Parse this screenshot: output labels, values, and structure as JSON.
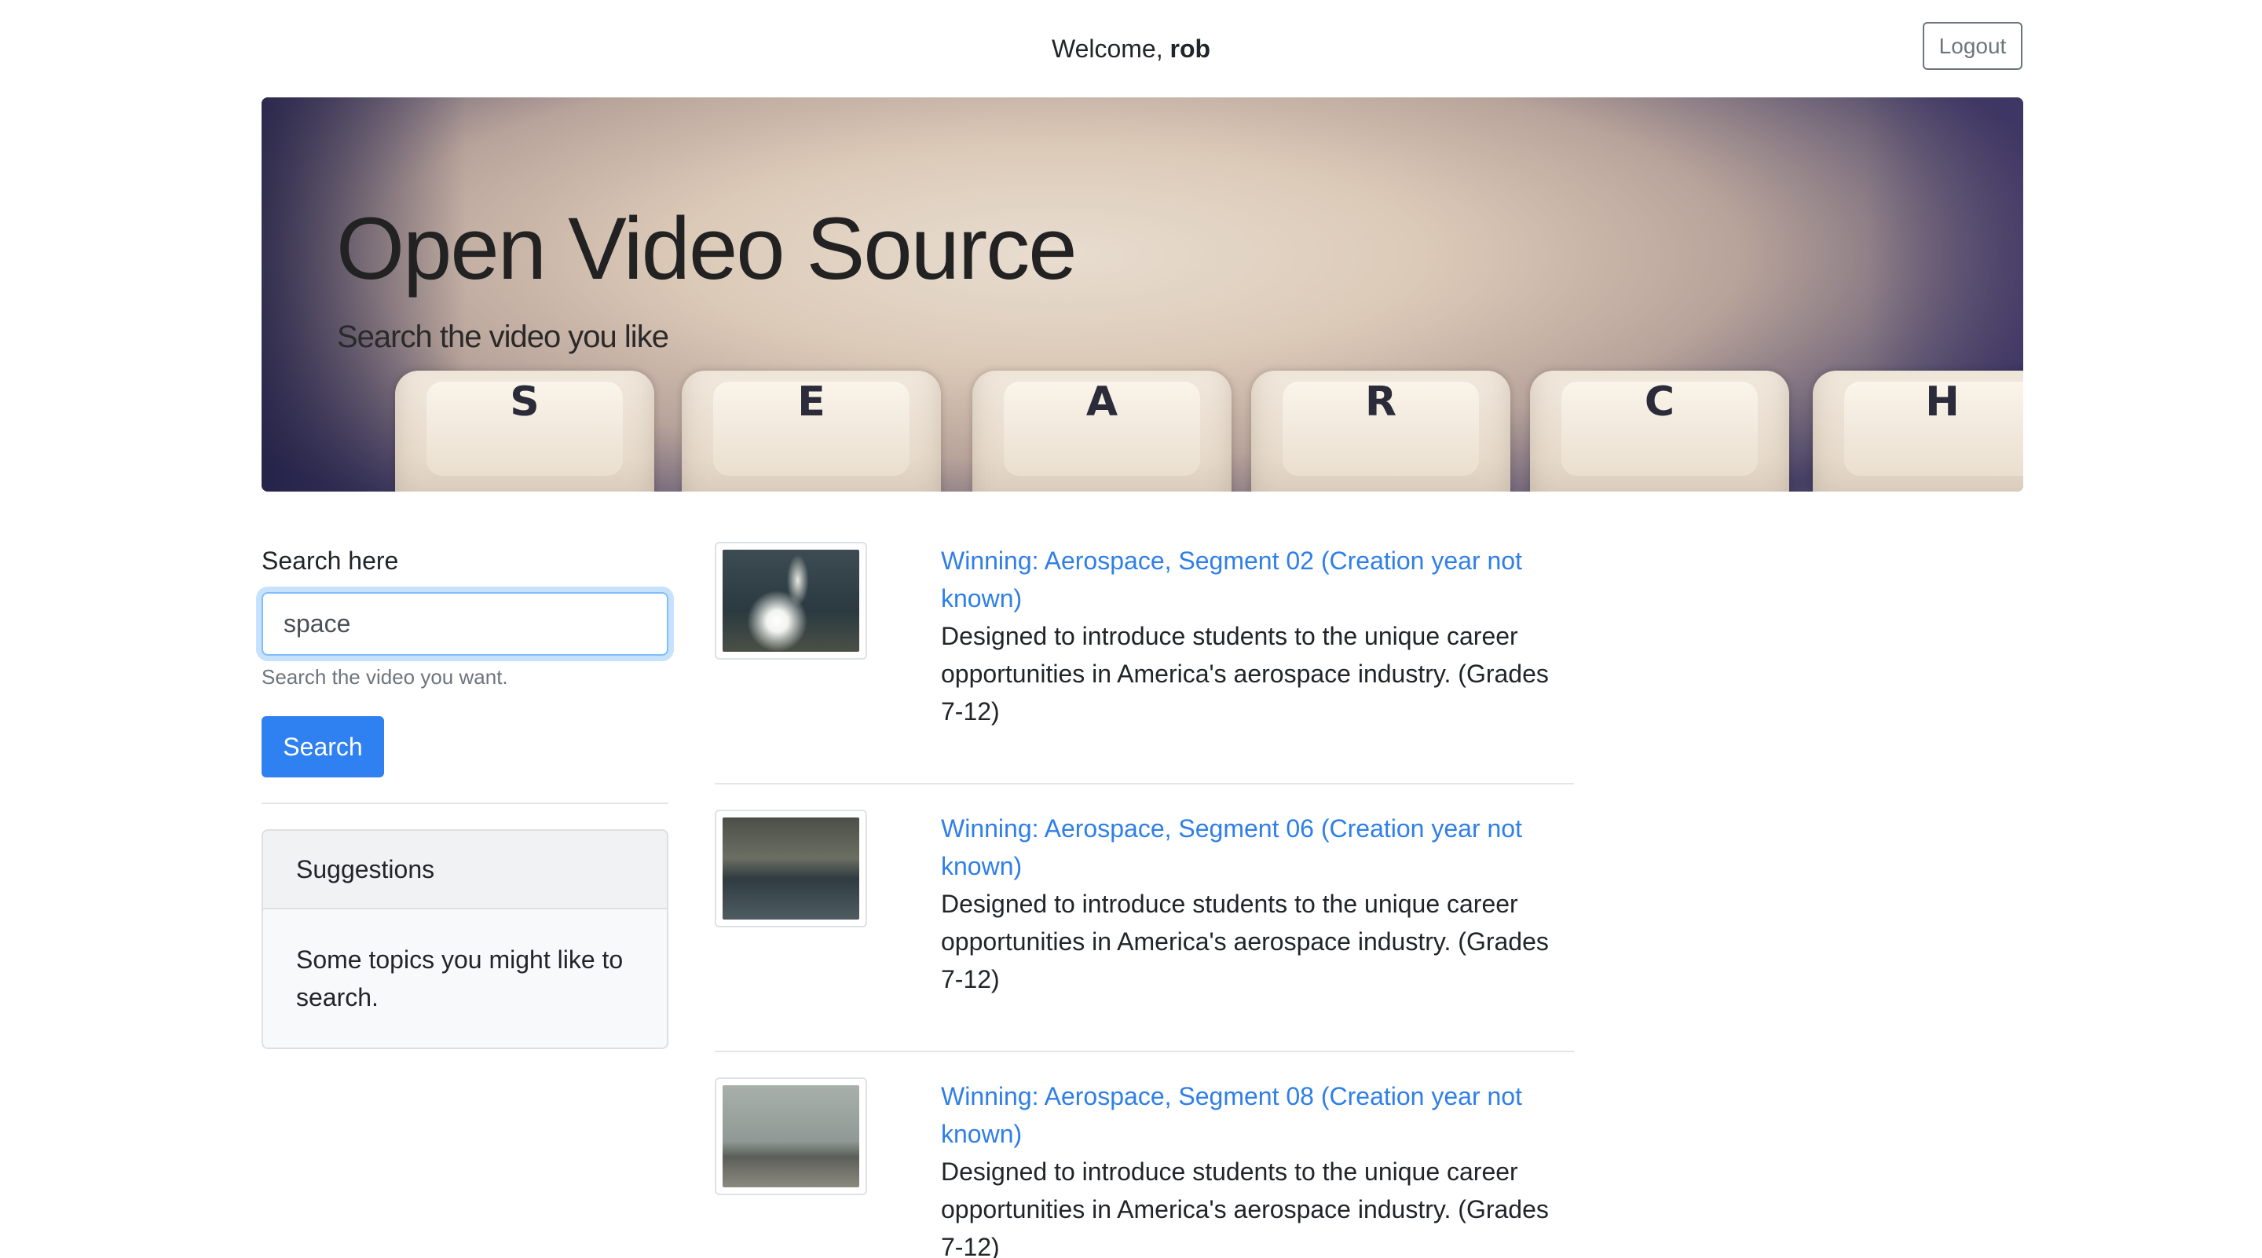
{
  "header": {
    "welcome_prefix": "Welcome,",
    "username": "rob",
    "logout_label": "Logout"
  },
  "jumbotron": {
    "title": "Open Video Source",
    "subtitle": "Search the video you like",
    "keys": [
      "S",
      "E",
      "A",
      "R",
      "C",
      "H"
    ]
  },
  "search": {
    "label": "Search here",
    "value": "space",
    "help": "Search the video you want.",
    "button_label": "Search"
  },
  "suggestions": {
    "header": "Suggestions",
    "body": "Some topics you might like to search."
  },
  "results": [
    {
      "title": "Winning: Aerospace, Segment 02 (Creation year not known)",
      "description": "Designed to introduce students to the unique career opportunities in America's aerospace industry. (Grades 7-12)"
    },
    {
      "title": "Winning: Aerospace, Segment 06 (Creation year not known)",
      "description": "Designed to introduce students to the unique career opportunities in America's aerospace industry. (Grades 7-12)"
    },
    {
      "title": "Winning: Aerospace, Segment 08 (Creation year not known)",
      "description": "Designed to introduce students to the unique career opportunities in America's aerospace industry. (Grades 7-12)"
    }
  ],
  "colors": {
    "primary": "#2f80f0",
    "link": "#2f7fe8",
    "muted": "#6c757d"
  }
}
